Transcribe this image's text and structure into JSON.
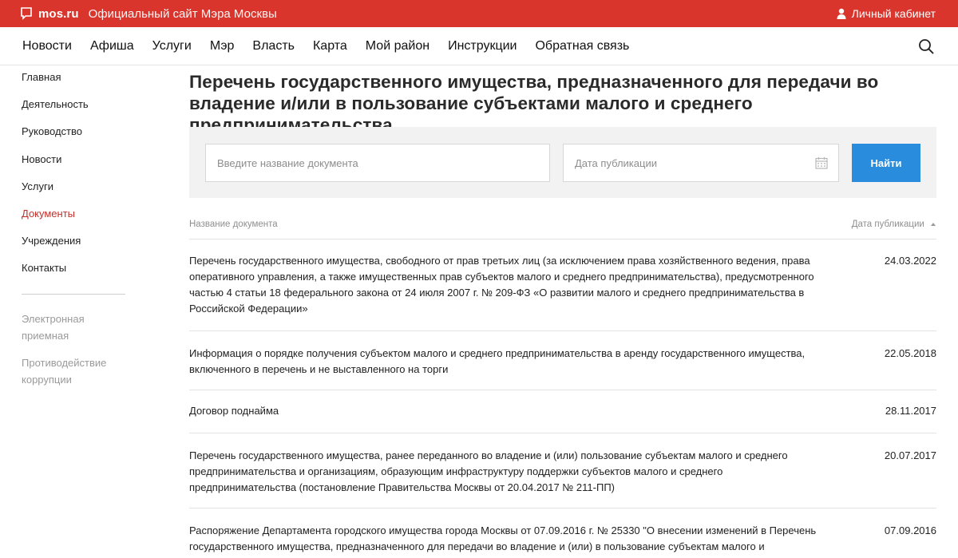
{
  "topbar": {
    "site_name": "mos.ru",
    "tagline": "Официальный сайт Мэра Москвы",
    "account_label": "Личный кабинет",
    "color": "#d9352c"
  },
  "nav": {
    "items": [
      "Новости",
      "Афиша",
      "Услуги",
      "Мэр",
      "Власть",
      "Карта",
      "Мой район",
      "Инструкции",
      "Обратная связь"
    ],
    "search_icon": "search-icon"
  },
  "sidebar": {
    "items": [
      {
        "label": "Главная"
      },
      {
        "label": "Деятельность"
      },
      {
        "label": "Руководство"
      },
      {
        "label": "Новости"
      },
      {
        "label": "Услуги"
      },
      {
        "label": "Документы",
        "active": true
      },
      {
        "label": "Учреждения"
      },
      {
        "label": "Контакты"
      }
    ],
    "secondary": [
      {
        "label": "Электронная приемная"
      },
      {
        "label": "Противодействие коррупции"
      }
    ],
    "active_color": "#c6302a"
  },
  "main": {
    "title": "Перечень государственного имущества, предназначенного для передачи во владение и/или в пользование субъектами малого и среднего предпринимательства",
    "search": {
      "doc_placeholder": "Введите название документа",
      "date_placeholder": "Дата публикации",
      "find_label": "Найти",
      "button_color": "#2a8cdd"
    },
    "table": {
      "col_name": "Название документа",
      "col_date": "Дата публикации",
      "rows": [
        {
          "title": "Перечень государственного имущества, свободного от прав третьих лиц (за исключением права хозяйственного ведения, права оперативного управления, а также имущественных прав субъектов малого и среднего предпринимательства), предусмотренного частью 4 статьи 18 федерального закона от 24 июля 2007 г. № 209-ФЗ «О развитии малого и среднего предпринимательства в Российской Федерации»",
          "date": "24.03.2022"
        },
        {
          "title": "Информация о порядке получения субъектом малого и среднего предпринимательства в аренду государственного имущества, включенного в перечень и не выставленного на торги",
          "date": "22.05.2018"
        },
        {
          "title": "Договор поднайма",
          "date": "28.11.2017"
        },
        {
          "title": "Перечень государственного имущества, ранее переданного во владение и (или) пользование субъектам малого и среднего предпринимательства и организациям, образующим инфраструктуру поддержки субъектов малого и среднего предпринимательства (постановление Правительства Москвы от 20.04.2017 № 211-ПП)",
          "date": "20.07.2017"
        },
        {
          "title": "Распоряжение Департамента городского имущества города Москвы от 07.09.2016 г. № 25330 \"О внесении изменений в Перечень государственного имущества, предназначенного для передачи во владение и (или) в пользование субъектам малого и",
          "date": "07.09.2016"
        }
      ]
    }
  }
}
